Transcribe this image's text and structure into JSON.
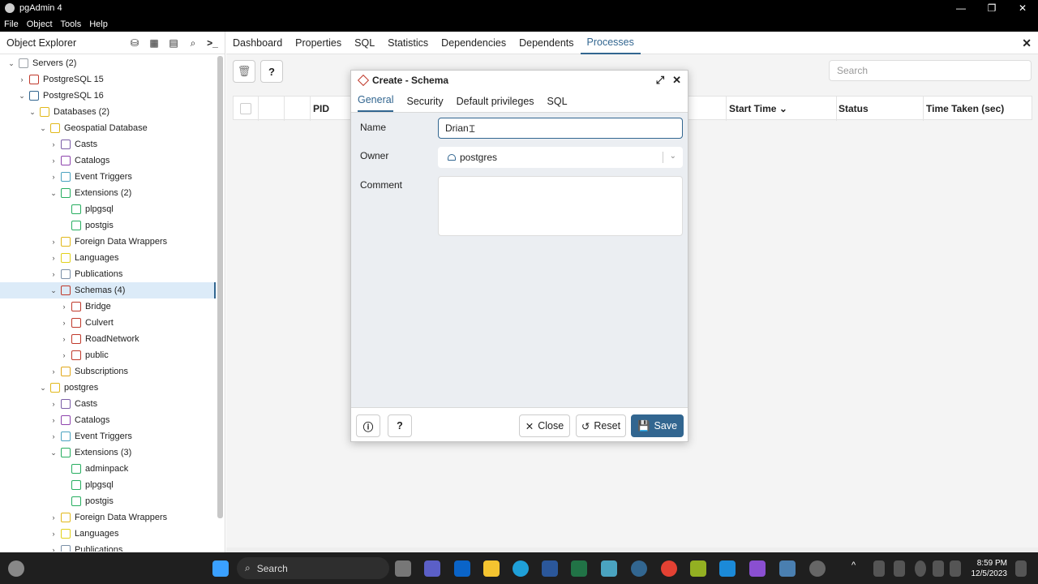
{
  "window": {
    "title": "pgAdmin 4"
  },
  "menu": [
    "File",
    "Object",
    "Tools",
    "Help"
  ],
  "explorer": {
    "title": "Object Explorer",
    "tree": [
      {
        "label": "Servers (2)",
        "indent": 0,
        "chev": "open",
        "color": "#9aa0a6"
      },
      {
        "label": "PostgreSQL 15",
        "indent": 1,
        "chev": "closed",
        "color": "#c0392b"
      },
      {
        "label": "PostgreSQL 16",
        "indent": 1,
        "chev": "open",
        "color": "#326690"
      },
      {
        "label": "Databases (2)",
        "indent": 2,
        "chev": "open",
        "color": "#e1b81a"
      },
      {
        "label": "Geospatial Database",
        "indent": 3,
        "chev": "open",
        "color": "#e1b81a"
      },
      {
        "label": "Casts",
        "indent": 4,
        "chev": "closed",
        "color": "#7b5ea7"
      },
      {
        "label": "Catalogs",
        "indent": 4,
        "chev": "closed",
        "color": "#8e44ad"
      },
      {
        "label": "Event Triggers",
        "indent": 4,
        "chev": "closed",
        "color": "#4aa3c0"
      },
      {
        "label": "Extensions (2)",
        "indent": 4,
        "chev": "open",
        "color": "#27ae60"
      },
      {
        "label": "plpgsql",
        "indent": 5,
        "chev": "none",
        "color": "#27ae60"
      },
      {
        "label": "postgis",
        "indent": 5,
        "chev": "none",
        "color": "#27ae60"
      },
      {
        "label": "Foreign Data Wrappers",
        "indent": 4,
        "chev": "closed",
        "color": "#e1b81a"
      },
      {
        "label": "Languages",
        "indent": 4,
        "chev": "closed",
        "color": "#e1d11a"
      },
      {
        "label": "Publications",
        "indent": 4,
        "chev": "closed",
        "color": "#7b8fa7"
      },
      {
        "label": "Schemas (4)",
        "indent": 4,
        "chev": "open",
        "color": "#c0392b",
        "selected": true
      },
      {
        "label": "Bridge",
        "indent": 5,
        "chev": "closed",
        "color": "#c0392b"
      },
      {
        "label": "Culvert",
        "indent": 5,
        "chev": "closed",
        "color": "#c0392b"
      },
      {
        "label": "RoadNetwork",
        "indent": 5,
        "chev": "closed",
        "color": "#c0392b"
      },
      {
        "label": "public",
        "indent": 5,
        "chev": "closed",
        "color": "#c0392b"
      },
      {
        "label": "Subscriptions",
        "indent": 4,
        "chev": "closed",
        "color": "#e1a81a"
      },
      {
        "label": "postgres",
        "indent": 3,
        "chev": "open",
        "color": "#e1b81a"
      },
      {
        "label": "Casts",
        "indent": 4,
        "chev": "closed",
        "color": "#7b5ea7"
      },
      {
        "label": "Catalogs",
        "indent": 4,
        "chev": "closed",
        "color": "#8e44ad"
      },
      {
        "label": "Event Triggers",
        "indent": 4,
        "chev": "closed",
        "color": "#4aa3c0"
      },
      {
        "label": "Extensions (3)",
        "indent": 4,
        "chev": "open",
        "color": "#27ae60"
      },
      {
        "label": "adminpack",
        "indent": 5,
        "chev": "none",
        "color": "#27ae60"
      },
      {
        "label": "plpgsql",
        "indent": 5,
        "chev": "none",
        "color": "#27ae60"
      },
      {
        "label": "postgis",
        "indent": 5,
        "chev": "none",
        "color": "#27ae60"
      },
      {
        "label": "Foreign Data Wrappers",
        "indent": 4,
        "chev": "closed",
        "color": "#e1b81a"
      },
      {
        "label": "Languages",
        "indent": 4,
        "chev": "closed",
        "color": "#e1d11a"
      },
      {
        "label": "Publications",
        "indent": 4,
        "chev": "closed",
        "color": "#7b8fa7"
      }
    ]
  },
  "main": {
    "tabs": [
      "Dashboard",
      "Properties",
      "SQL",
      "Statistics",
      "Dependencies",
      "Dependents",
      "Processes"
    ],
    "active_tab": "Processes",
    "search_placeholder": "Search",
    "columns": [
      "PID",
      "Start Time",
      "Status",
      "Time Taken (sec)"
    ]
  },
  "dialog": {
    "title": "Create - Schema",
    "tabs": [
      "General",
      "Security",
      "Default privileges",
      "SQL"
    ],
    "active_tab": "General",
    "name_label": "Name",
    "name_value": "Drian",
    "owner_label": "Owner",
    "owner_value": "postgres",
    "comment_label": "Comment",
    "close_label": "Close",
    "reset_label": "Reset",
    "save_label": "Save"
  },
  "taskbar": {
    "search_label": "Search",
    "time": "8:59 PM",
    "date": "12/5/2023"
  },
  "colors": {
    "accent": "#326690",
    "selected_bg": "#dcebf8"
  }
}
